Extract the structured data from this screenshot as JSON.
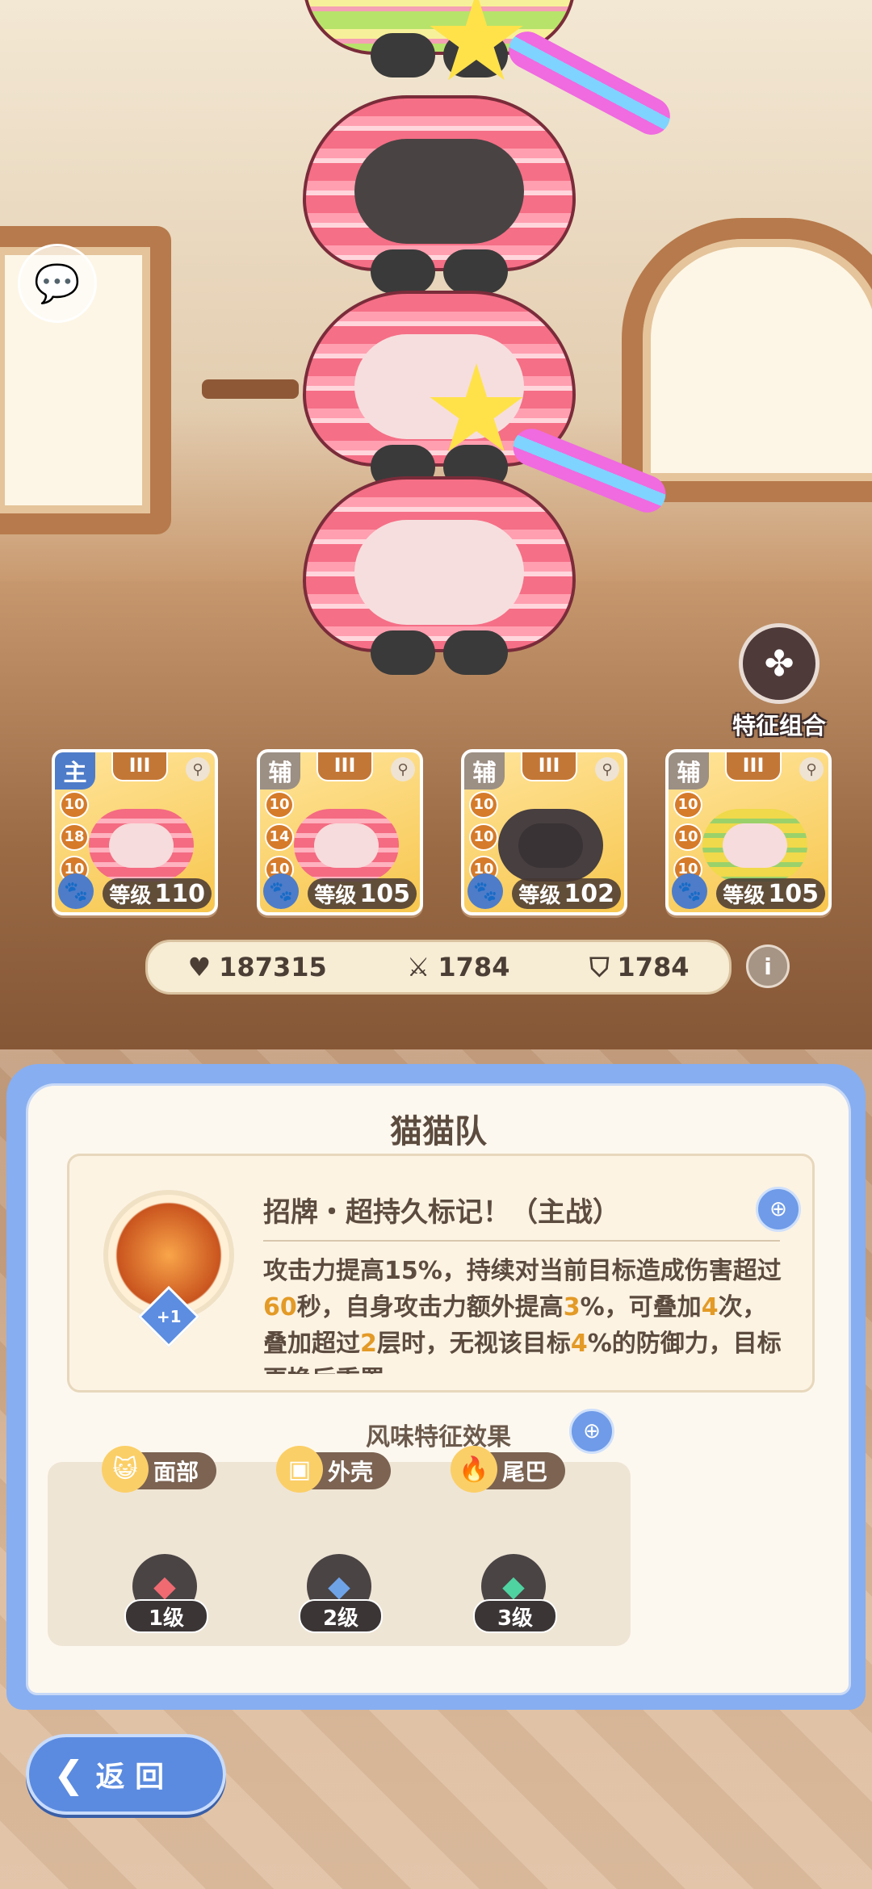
{
  "scene": {
    "trait_combo_label": "特征组合",
    "trait_combo_icon": "quad-leaf-icon",
    "chat_icon": "chat-bubbles-icon"
  },
  "team": {
    "cards": [
      {
        "role": "主",
        "rank": "III",
        "stats": [
          "10",
          "18",
          "10"
        ],
        "level_prefix": "等级",
        "level": "110"
      },
      {
        "role": "辅",
        "rank": "III",
        "stats": [
          "10",
          "14",
          "10"
        ],
        "level_prefix": "等级",
        "level": "105"
      },
      {
        "role": "辅",
        "rank": "III",
        "stats": [
          "10",
          "10",
          "10"
        ],
        "level_prefix": "等级",
        "level": "102"
      },
      {
        "role": "辅",
        "rank": "III",
        "stats": [
          "10",
          "10",
          "10"
        ],
        "level_prefix": "等级",
        "level": "105"
      }
    ]
  },
  "totals": {
    "hp": "187315",
    "attack": "1784",
    "defense": "1784"
  },
  "panel": {
    "title": "猫猫队",
    "skill": {
      "name": "招牌・超持久标记！（主战）",
      "plus_badge": "+1",
      "desc_parts": [
        {
          "t": "攻击力提高15%，持续对当前目标造成伤害超过",
          "hl": false
        },
        {
          "t": "60",
          "hl": true
        },
        {
          "t": "秒，自身攻击力额外提高",
          "hl": false
        },
        {
          "t": "3",
          "hl": true
        },
        {
          "t": "%，可叠加",
          "hl": false
        },
        {
          "t": "4",
          "hl": true
        },
        {
          "t": "次，叠加超过",
          "hl": false
        },
        {
          "t": "2",
          "hl": true
        },
        {
          "t": "层时，无视该目标",
          "hl": false
        },
        {
          "t": "4",
          "hl": true
        },
        {
          "t": "%的防御力，目标更换后重置",
          "hl": false
        }
      ]
    },
    "flavor_title": "风味特征效果",
    "traits": [
      {
        "label": "面部",
        "level": "1级",
        "icon": "cat-face-icon",
        "gem_color": "#f06a72"
      },
      {
        "label": "外壳",
        "level": "2级",
        "icon": "shell-icon",
        "gem_color": "#6fa3e8"
      },
      {
        "label": "尾巴",
        "level": "3级",
        "icon": "flame-tail-icon",
        "gem_color": "#4fd3a1"
      }
    ]
  },
  "back_label": "返 回"
}
